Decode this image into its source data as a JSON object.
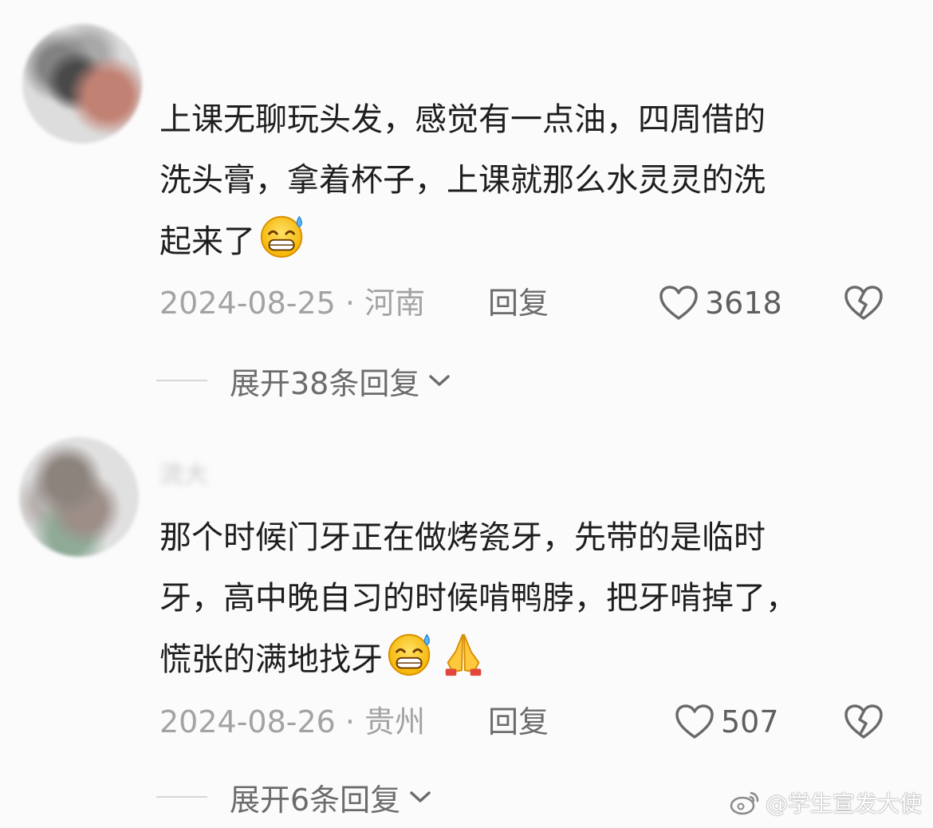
{
  "comments": [
    {
      "username": "",
      "text": "上课无聊玩头发，感觉有一点油，四周借的\n洗头膏，拿着杯子，上课就那么水灵灵的洗\n起来了",
      "emojis": [
        "grinning-sweat-emoji"
      ],
      "date_location": "2024-08-25 · 河南",
      "reply_label": "回复",
      "likes": "3618",
      "expand_label": "展开38条回复"
    },
    {
      "username": "流大",
      "text": "那个时候门牙正在做烤瓷牙，先带的是临时\n牙，高中晚自习的时候啃鸭脖，把牙啃掉了，\n慌张的满地找牙",
      "emojis": [
        "grinning-sweat-emoji",
        "praying-hands-emoji"
      ],
      "date_location": "2024-08-26 · 贵州",
      "reply_label": "回复",
      "likes": "507",
      "expand_label": "展开6条回复"
    }
  ],
  "watermark": "@学生宣发大使",
  "icons": {
    "like": "heart-outline-icon",
    "dislike": "broken-heart-icon",
    "expand": "chevron-down-icon",
    "watermark": "weibo-icon"
  },
  "colors": {
    "background": "#fbfbfb",
    "text": "#1e1e1e",
    "meta": "#a3a3a3",
    "action": "#6c6c6c"
  }
}
